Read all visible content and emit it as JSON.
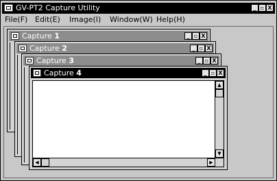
{
  "app": {
    "title": "GV-PT2 Capture Utility",
    "menu": [
      {
        "label": "File(F)"
      },
      {
        "label": "Edit(E)"
      },
      {
        "label": "Image(I)"
      },
      {
        "label": "Window(W)"
      },
      {
        "label": "Help(H)"
      }
    ],
    "buttons": {
      "minimize": "_",
      "restore": "▫",
      "close": "X"
    }
  },
  "windows": [
    {
      "name": "Capture",
      "num": "1"
    },
    {
      "name": "Capture",
      "num": "2"
    },
    {
      "name": "Capture",
      "num": "3"
    },
    {
      "name": "Capture",
      "num": "4"
    }
  ],
  "scroll": {
    "up": "▲",
    "down": "▼",
    "left": "◀",
    "right": "▶"
  }
}
